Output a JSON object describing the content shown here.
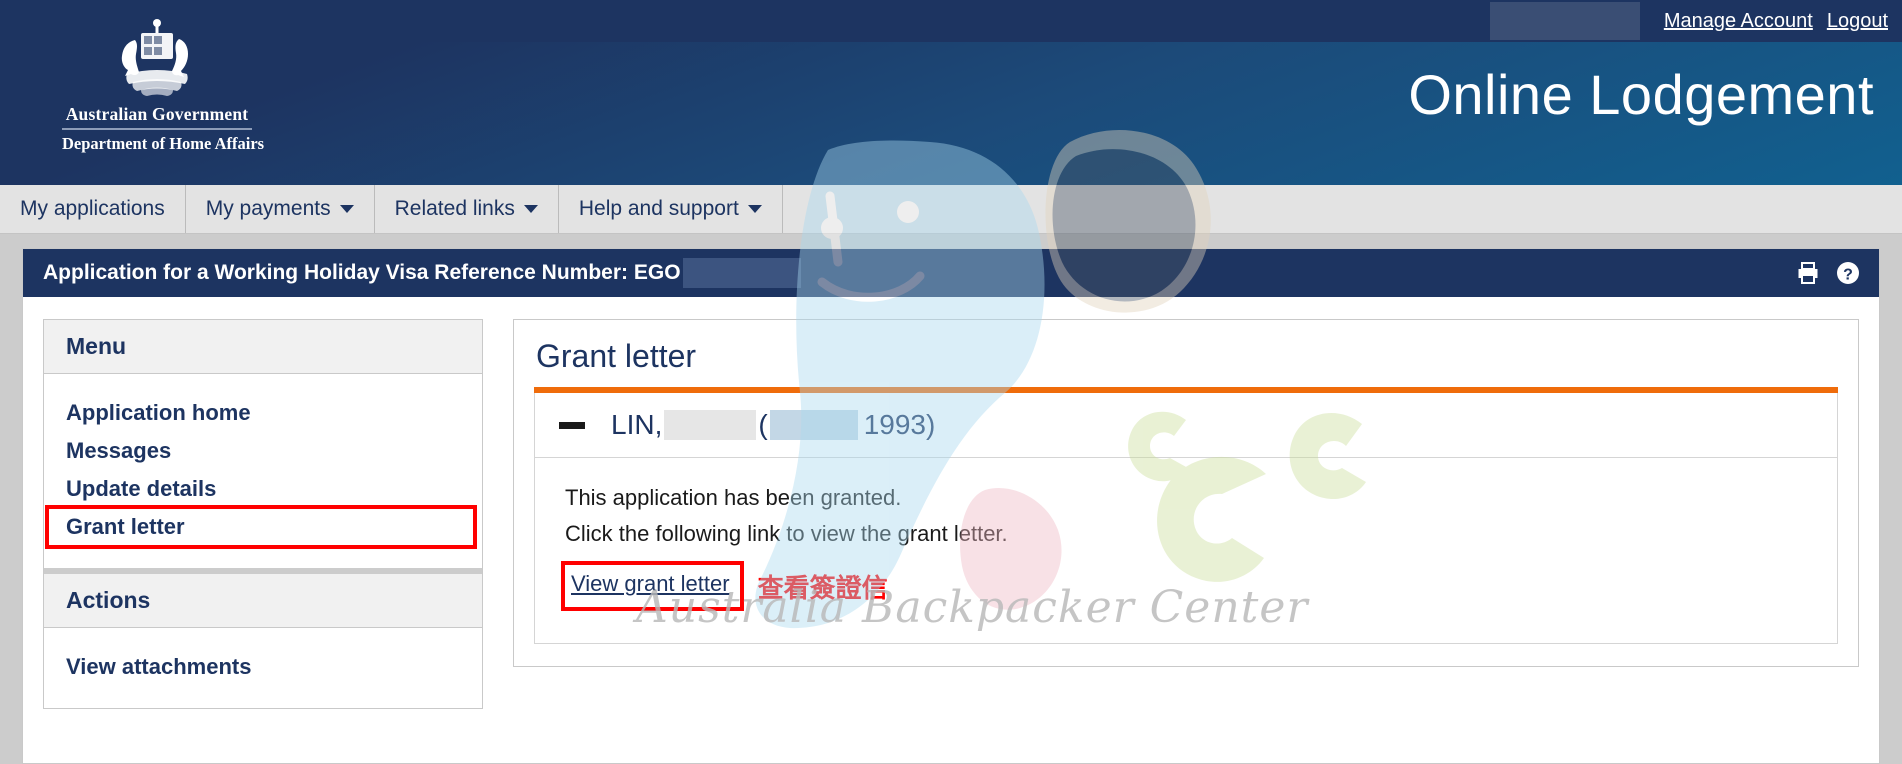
{
  "header": {
    "org_line1": "Australian Government",
    "org_line2": "Department of Home Affairs",
    "site_title": "Online Lodgement",
    "manage_account": "Manage Account",
    "logout": "Logout"
  },
  "nav": {
    "items": [
      {
        "label": "My applications",
        "has_caret": false
      },
      {
        "label": "My payments",
        "has_caret": true
      },
      {
        "label": "Related links",
        "has_caret": true
      },
      {
        "label": "Help and support",
        "has_caret": true
      }
    ]
  },
  "app_bar": {
    "title": "Application for a Working Holiday Visa Reference Number: EGO",
    "print_icon": "printer-icon",
    "help_icon": "help-circle-icon"
  },
  "sidebar": {
    "menu_heading": "Menu",
    "menu_items": [
      {
        "label": "Application home",
        "highlighted": false
      },
      {
        "label": "Messages",
        "highlighted": false
      },
      {
        "label": "Update details",
        "highlighted": false
      },
      {
        "label": "Grant letter",
        "highlighted": true
      }
    ],
    "actions_heading": "Actions",
    "actions_items": [
      {
        "label": "View attachments"
      }
    ]
  },
  "main": {
    "panel_title": "Grant letter",
    "person": {
      "surname": "LIN,",
      "open_paren": "(",
      "year": "1993)"
    },
    "body_line1": "This application has been granted.",
    "body_line2": "Click the following link to view the grant letter.",
    "grant_link": "View grant letter",
    "annotation_cn": "查看簽證信"
  },
  "watermark": {
    "text": "Australia Backpacker Center"
  },
  "colors": {
    "navy": "#1d3461",
    "header_blue": "#11608f",
    "orange_rule": "#ef6c0b",
    "annotation_red": "#ff0000",
    "nav_grey": "#e3e3e3",
    "page_grey": "#cccccc"
  }
}
